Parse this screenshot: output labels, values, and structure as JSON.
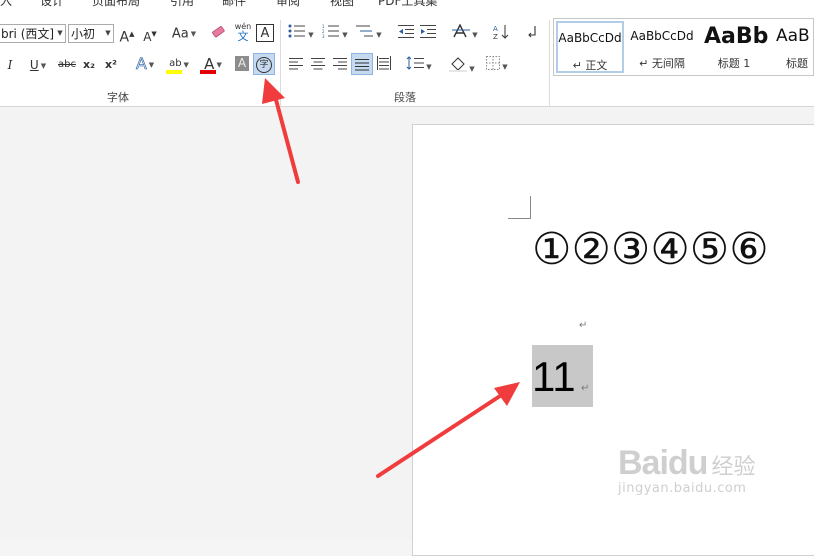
{
  "menu": {
    "items": [
      "入",
      "设计",
      "页面布局",
      "引用",
      "邮件",
      "审阅",
      "视图",
      "PDF工具集"
    ]
  },
  "font_group": {
    "font_name": "bri (西文]",
    "font_size": "小初",
    "grow_font": "A",
    "shrink_font": "A",
    "change_case": "Aa",
    "phonetic_top": "wén",
    "phonetic_bottom": "文",
    "char_border": "A",
    "italic": "I",
    "underline": "U",
    "strikethrough": "abc",
    "subscript": "x₂",
    "superscript": "x²",
    "text_effect": "A",
    "highlight": "ab",
    "font_color": "A",
    "char_shading": "A",
    "enclose_char": "字",
    "label": "字体"
  },
  "paragraph_group": {
    "label": "段落"
  },
  "styles": {
    "items": [
      {
        "preview": "AaBbCcDd",
        "name": "↵ 正文",
        "selected": true
      },
      {
        "preview": "AaBbCcDd",
        "name": "↵ 无间隔",
        "selected": false
      },
      {
        "preview": "AaBb",
        "name": "标题 1",
        "selected": false
      },
      {
        "preview": "AaB",
        "name": "标题",
        "selected": false
      }
    ]
  },
  "document": {
    "circled_numbers": "①②③④⑤⑥",
    "paragraph_mark": "↵",
    "selected_text": "11"
  },
  "watermark": {
    "logo": "Baidu",
    "cn": "经验",
    "url": "jingyan.baidu.com"
  },
  "colors": {
    "highlight_yellow": "#ffff00",
    "font_red": "#e00000",
    "arrow_red": "#f03c3c",
    "selection_gray": "#c8c8c8",
    "active_button": "#c5daf0"
  }
}
